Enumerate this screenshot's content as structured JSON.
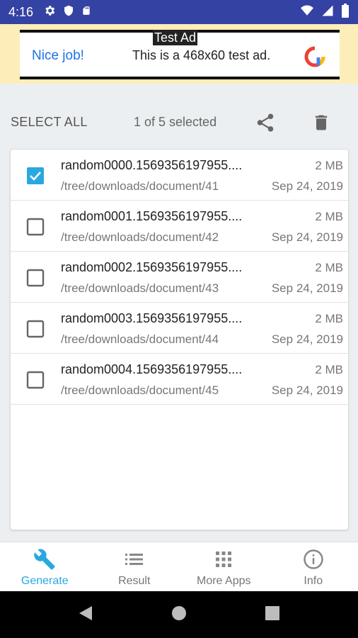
{
  "status_bar": {
    "time": "4:16",
    "left_icons": [
      "gear-icon",
      "shield-icon",
      "sd-card-icon"
    ],
    "right_icons": [
      "wifi-icon",
      "signal-icon",
      "battery-icon"
    ]
  },
  "ad": {
    "tag": "Test Ad",
    "headline": "Nice job!",
    "description": "This is a 468x60 test ad.",
    "logo_icon": "ad-logo-icon"
  },
  "toolbar": {
    "select_all": "SELECT ALL",
    "selection_count": "1 of 5 selected",
    "share_icon": "share-icon",
    "delete_icon": "trash-icon"
  },
  "files": [
    {
      "name": "random0000.1569356197955....",
      "path": "/tree/downloads/document/41",
      "size": "2 MB",
      "date": "Sep 24, 2019",
      "checked": true
    },
    {
      "name": "random0001.1569356197955....",
      "path": "/tree/downloads/document/42",
      "size": "2 MB",
      "date": "Sep 24, 2019",
      "checked": false
    },
    {
      "name": "random0002.1569356197955....",
      "path": "/tree/downloads/document/43",
      "size": "2 MB",
      "date": "Sep 24, 2019",
      "checked": false
    },
    {
      "name": "random0003.1569356197955....",
      "path": "/tree/downloads/document/44",
      "size": "2 MB",
      "date": "Sep 24, 2019",
      "checked": false
    },
    {
      "name": "random0004.1569356197955....",
      "path": "/tree/downloads/document/45",
      "size": "2 MB",
      "date": "Sep 24, 2019",
      "checked": false
    }
  ],
  "bottom_nav": {
    "items": [
      {
        "label": "Generate",
        "icon": "wrench-icon",
        "active": true
      },
      {
        "label": "Result",
        "icon": "list-icon",
        "active": false
      },
      {
        "label": "More Apps",
        "icon": "grid-icon",
        "active": false
      },
      {
        "label": "Info",
        "icon": "info-icon",
        "active": false
      }
    ]
  },
  "colors": {
    "status_bar": "#3342a3",
    "accent": "#29a8e0",
    "ad_background": "#fdedb8"
  }
}
